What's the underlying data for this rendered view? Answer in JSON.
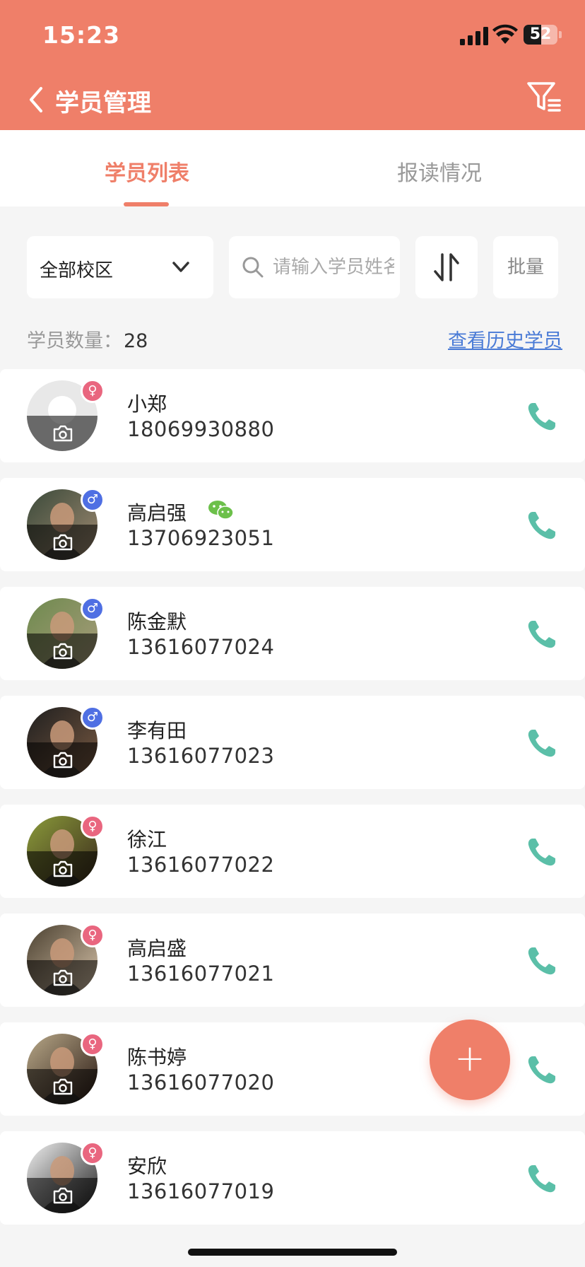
{
  "status_bar": {
    "time": "15:23",
    "battery": "52",
    "battery_level": 0.52
  },
  "header": {
    "title": "学员管理"
  },
  "tabs": [
    {
      "label": "学员列表",
      "active": true
    },
    {
      "label": "报读情况",
      "active": false
    }
  ],
  "filters": {
    "campus": "全部校区",
    "search_placeholder": "请输入学员姓名",
    "batch_label": "批量"
  },
  "summary": {
    "count_label": "学员数量：",
    "count": "28",
    "history_link": "查看历史学员"
  },
  "students": [
    {
      "name": "小郑",
      "phone": "18069930880",
      "gender": "female",
      "gender_symbol": "♀",
      "wechat": false,
      "avatar": "placeholder"
    },
    {
      "name": "高启强",
      "phone": "13706923051",
      "gender": "male",
      "gender_symbol": "♂",
      "wechat": true,
      "avatar": "photo"
    },
    {
      "name": "陈金默",
      "phone": "13616077024",
      "gender": "male",
      "gender_symbol": "♂",
      "wechat": false,
      "avatar": "photo"
    },
    {
      "name": "李有田",
      "phone": "13616077023",
      "gender": "male",
      "gender_symbol": "♂",
      "wechat": false,
      "avatar": "photo"
    },
    {
      "name": "徐江",
      "phone": "13616077022",
      "gender": "female",
      "gender_symbol": "♀",
      "wechat": false,
      "avatar": "photo"
    },
    {
      "name": "高启盛",
      "phone": "13616077021",
      "gender": "female",
      "gender_symbol": "♀",
      "wechat": false,
      "avatar": "photo"
    },
    {
      "name": "陈书婷",
      "phone": "13616077020",
      "gender": "female",
      "gender_symbol": "♀",
      "wechat": false,
      "avatar": "photo"
    },
    {
      "name": "安欣",
      "phone": "13616077019",
      "gender": "female",
      "gender_symbol": "♀",
      "wechat": false,
      "avatar": "photo"
    }
  ],
  "fab": {
    "label": "+"
  },
  "colors": {
    "accent": "#ef7f69",
    "female": "#e9667f",
    "male": "#4f6fe3",
    "call": "#5bbfa8",
    "link": "#4a7bd6",
    "wechat": "#6cc04a"
  }
}
